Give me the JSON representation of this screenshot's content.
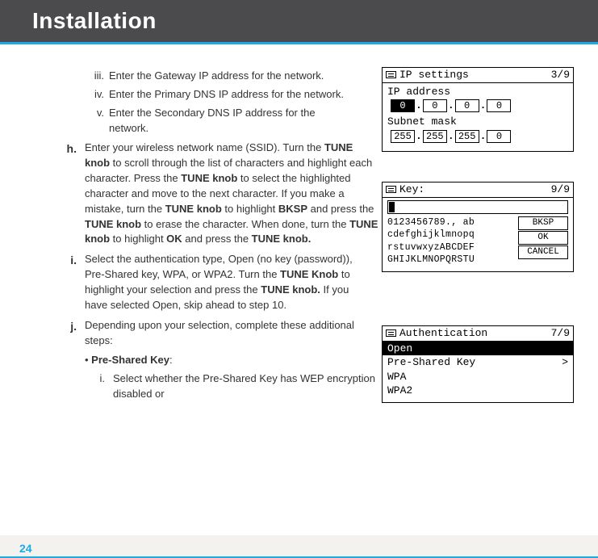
{
  "header": {
    "title": "Installation"
  },
  "page_number": "24",
  "steps": {
    "iii": {
      "marker": "iii.",
      "text": "Enter the Gateway IP address for the network."
    },
    "iv": {
      "marker": "iv.",
      "text": "Enter the Primary DNS IP address for the network."
    },
    "v": {
      "marker": "v.",
      "text": "Enter the Secondary DNS IP address for the network."
    },
    "h": {
      "marker": "h.",
      "segments": [
        "Enter your wireless network name (SSID). Turn the ",
        "TUNE knob",
        " to scroll through the list of characters and highlight each character. Press the ",
        "TUNE knob",
        " to select the highlighted character and move to the next character. If you make a mistake, turn the ",
        "TUNE knob",
        " to highlight ",
        "BKSP",
        " and press the ",
        "TUNE knob",
        " to erase the character. When done, turn the ",
        "TUNE knob",
        " to highlight ",
        "OK",
        " and press the ",
        "TUNE knob.",
        ""
      ]
    },
    "i": {
      "marker": "i.",
      "segments": [
        "Select the authentication type, Open (no key (password)), Pre-Shared key, WPA, or WPA2. Turn the ",
        "TUNE Knob",
        " to highlight your selection and press the ",
        "TUNE knob.",
        " If you have selected Open, skip ahead to step 10."
      ]
    },
    "j": {
      "marker": "j.",
      "text": "Depending upon your selection, complete these additional steps:",
      "bullet_label": "Pre-Shared Key",
      "bullet_colon": ":",
      "sub_i_marker": "i.",
      "sub_i_text": "Select whether the Pre-Shared Key has WEP encryption disabled or"
    }
  },
  "lcd1": {
    "title": "IP settings",
    "page": "3/9",
    "ip_label": "IP address",
    "ip_values": [
      "0",
      "0",
      "0",
      "0"
    ],
    "subnet_label": "Subnet mask",
    "subnet_values": [
      "255",
      "255",
      "255",
      "0"
    ]
  },
  "lcd2": {
    "title": "Key:",
    "page": "9/9",
    "chars_line1": "0123456789., ab",
    "chars_line2": "cdefghijklmnopq",
    "chars_line3": "rstuvwxyzABCDEF",
    "chars_line4": "GHIJKLMNOPQRSTU",
    "btn_bksp": "BKSP",
    "btn_ok": "OK",
    "btn_cancel": "CANCEL"
  },
  "lcd3": {
    "title": "Authentication",
    "page": "7/9",
    "items": [
      {
        "label": "Open",
        "selected": true,
        "chevron": ""
      },
      {
        "label": "Pre-Shared Key",
        "selected": false,
        "chevron": ">"
      },
      {
        "label": "WPA",
        "selected": false,
        "chevron": ""
      },
      {
        "label": "WPA2",
        "selected": false,
        "chevron": ""
      }
    ]
  }
}
